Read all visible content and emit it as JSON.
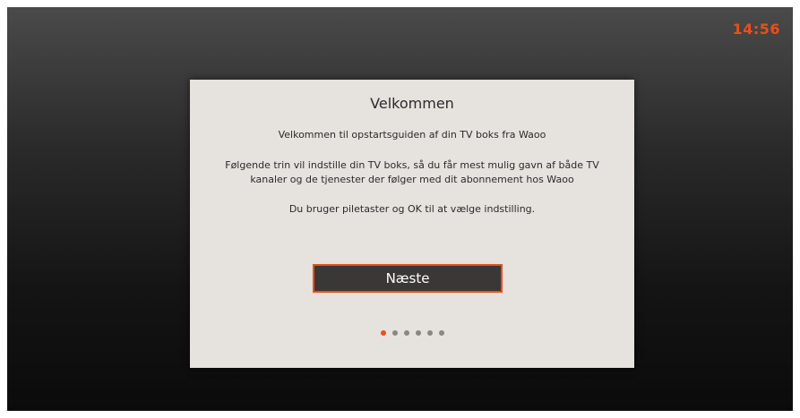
{
  "clock": {
    "time": "14:56"
  },
  "dialog": {
    "title": "Velkommen",
    "intro": "Velkommen til opstartsguiden af din TV boks fra Waoo",
    "description": "Følgende trin vil indstille din TV boks, så du får mest mulig gavn af både TV kanaler og de tjenester der følger med dit abonnement hos Waoo",
    "instruction": "Du bruger piletaster og OK til at vælge indstilling.",
    "next_label": "Næste"
  },
  "progress": {
    "total_steps": 6,
    "current_step": 1
  },
  "colors": {
    "accent": "#e8501c",
    "dialog_bg": "#e6e2dd",
    "button_bg": "#3a3837"
  }
}
